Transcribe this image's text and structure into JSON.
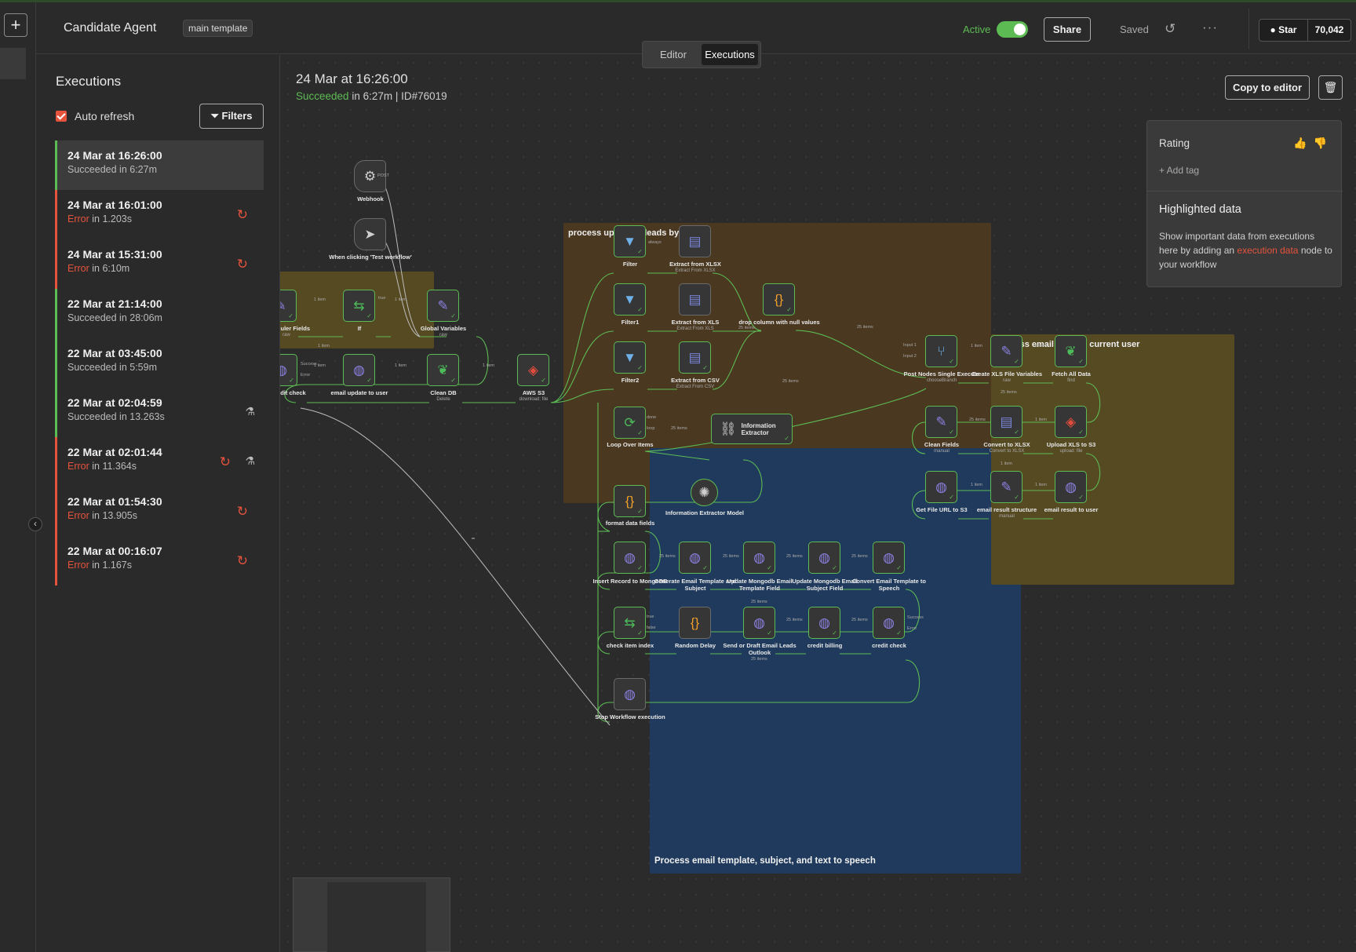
{
  "header": {
    "workflow_name": "Candidate Agent",
    "tag": "main template",
    "active_label": "Active",
    "share_label": "Share",
    "saved_label": "Saved",
    "github_star_label": "Star",
    "github_star_count": "70,042"
  },
  "tabs": [
    {
      "label": "Editor",
      "active": false
    },
    {
      "label": "Executions",
      "active": true
    }
  ],
  "executions_panel": {
    "title": "Executions",
    "auto_refresh_label": "Auto refresh",
    "auto_refresh_checked": true,
    "filters_label": "Filters",
    "items": [
      {
        "time": "24 Mar at 16:26:00",
        "status": "Succeeded",
        "duration_text": " in 6:27m",
        "state": "success",
        "selected": true,
        "retry": false,
        "test": false
      },
      {
        "time": "24 Mar at 16:01:00",
        "status": "Error",
        "duration_text": " in 1.203s",
        "state": "error",
        "selected": false,
        "retry": true,
        "test": false
      },
      {
        "time": "24 Mar at 15:31:00",
        "status": "Error",
        "duration_text": " in 6:10m",
        "state": "error",
        "selected": false,
        "retry": true,
        "test": false
      },
      {
        "time": "22 Mar at 21:14:00",
        "status": "Succeeded",
        "duration_text": " in 28:06m",
        "state": "success",
        "selected": false,
        "retry": false,
        "test": false
      },
      {
        "time": "22 Mar at 03:45:00",
        "status": "Succeeded",
        "duration_text": " in 5:59m",
        "state": "success",
        "selected": false,
        "retry": false,
        "test": false
      },
      {
        "time": "22 Mar at 02:04:59",
        "status": "Succeeded",
        "duration_text": " in 13.263s",
        "state": "success",
        "selected": false,
        "retry": false,
        "test": true
      },
      {
        "time": "22 Mar at 02:01:44",
        "status": "Error",
        "duration_text": " in 11.364s",
        "state": "error",
        "selected": false,
        "retry": true,
        "test": true
      },
      {
        "time": "22 Mar at 01:54:30",
        "status": "Error",
        "duration_text": " in 13.905s",
        "state": "error",
        "selected": false,
        "retry": true,
        "test": false
      },
      {
        "time": "22 Mar at 00:16:07",
        "status": "Error",
        "duration_text": " in 1.167s",
        "state": "error",
        "selected": false,
        "retry": true,
        "test": false
      }
    ]
  },
  "execution_detail": {
    "date": "24 Mar at 16:26:00",
    "status": "Succeeded",
    "summary_rest": " in 6:27m | ID#76019",
    "copy_to_editor_label": "Copy to editor"
  },
  "rating_panel": {
    "rating_label": "Rating",
    "add_tag_label": "+ Add tag",
    "highlighted_title": "Highlighted data",
    "highlighted_body_1": "Show important data from executions here by adding an ",
    "highlighted_link": "execution data",
    "highlighted_body_2": " node to your workflow"
  },
  "groups": {
    "uploaded": "process uploaded leads by user",
    "email_send": "Process email send to current user",
    "template": "Process email template, subject, and text to speech"
  },
  "nodes": {
    "webhook": {
      "label": "Webhook",
      "icon": "webhook-icon"
    },
    "manual_trigger": {
      "label": "When clicking 'Test workflow'",
      "icon": "cursor-icon"
    },
    "scheduler_fields": {
      "label": "Scheduler Fields",
      "sub": "raw",
      "icon": "pencil-icon"
    },
    "if": {
      "label": "If",
      "icon": "if-icon"
    },
    "global_variables": {
      "label": "Global Variables",
      "sub": "raw",
      "icon": "pencil-icon"
    },
    "initial_credit_check": {
      "label": "Initial credit check",
      "icon": "globe-icon"
    },
    "email_update_to_user": {
      "label": "email update to user",
      "icon": "globe-icon"
    },
    "clean_db": {
      "label": "Clean DB",
      "sub": "Delete",
      "icon": "mongodb-icon"
    },
    "aws_s3": {
      "label": "AWS S3",
      "sub": "download: file",
      "icon": "aws-s3-icon"
    },
    "filter": {
      "label": "Filter",
      "icon": "filter-icon"
    },
    "filter1": {
      "label": "Filter1",
      "icon": "filter-icon"
    },
    "filter2": {
      "label": "Filter2",
      "icon": "filter-icon"
    },
    "extract_xlsx": {
      "label": "Extract from XLSX",
      "sub": "Extract From XLSX",
      "icon": "file-icon"
    },
    "extract_xls": {
      "label": "Extract from XLS",
      "sub": "Extract From XLS",
      "icon": "file-icon"
    },
    "extract_csv": {
      "label": "Extract from CSV",
      "sub": "Extract From CSV",
      "icon": "file-icon"
    },
    "drop_column": {
      "label": "drop column with null values",
      "icon": "code-icon"
    },
    "loop_over_items": {
      "label": "Loop Over Items",
      "icon": "loop-icon"
    },
    "information_extractor": {
      "label": "Information Extractor",
      "icon": "extractor-icon"
    },
    "information_extractor_model": {
      "label": "Information Extractor Model",
      "icon": "openai-icon"
    },
    "format_data_fields": {
      "label": "format data fields",
      "icon": "code-icon"
    },
    "insert_record": {
      "label": "Insert Record to MongoDB",
      "icon": "globe-icon"
    },
    "generate_email_template": {
      "label": "Generate Email Template and Subject",
      "icon": "globe-icon"
    },
    "update_mongodb_template": {
      "label": "Update Mongodb Email Template Field",
      "icon": "globe-icon"
    },
    "update_mongodb_subject": {
      "label": "Update Mongodb Email Subject Field",
      "icon": "globe-icon"
    },
    "convert_email_template": {
      "label": "Convert Email Template to Speech",
      "icon": "globe-icon"
    },
    "check_item_index": {
      "label": "check item index",
      "icon": "if-icon"
    },
    "random_delay": {
      "label": "Random Delay",
      "icon": "code-icon"
    },
    "send_or_draft": {
      "label": "Send or Draft Email Leads Outlook",
      "icon": "globe-icon"
    },
    "credit_billing": {
      "label": "credit billing",
      "icon": "globe-icon"
    },
    "credit_check": {
      "label": "credit check",
      "icon": "globe-icon"
    },
    "stop_workflow": {
      "label": "Stop Workflow execution",
      "icon": "globe-icon"
    },
    "post_nodes": {
      "label": "Post Nodes Single Execute",
      "sub": "chooseBranch",
      "icon": "merge-icon"
    },
    "create_xls_vars": {
      "label": "Create XLS File Variables",
      "sub": "raw",
      "icon": "pencil-icon"
    },
    "fetch_all_data": {
      "label": "Fetch All Data",
      "sub": "find",
      "icon": "mongodb-icon"
    },
    "clean_fields": {
      "label": "Clean Fields",
      "sub": "manual",
      "icon": "pencil-icon"
    },
    "convert_to_xlsx": {
      "label": "Convert to XLSX",
      "sub": "Convert to XLSX",
      "icon": "file-icon"
    },
    "upload_xls_s3": {
      "label": "Upload XLS to S3",
      "sub": "upload: file",
      "icon": "aws-s3-icon"
    },
    "get_file_url": {
      "label": "Get File URL to S3",
      "icon": "globe-icon"
    },
    "email_result_structure": {
      "label": "email result structure",
      "sub": "manual",
      "icon": "pencil-icon"
    },
    "email_result_to_user": {
      "label": "email result to user",
      "icon": "globe-icon"
    }
  },
  "edge_labels": {
    "one_item": "1 item",
    "items_25": "25 items",
    "true": "true",
    "false": "false",
    "always": "always",
    "done": "done",
    "loop": "loop",
    "success": "Success",
    "error": "Error",
    "post": "POST",
    "input1": "Input 1",
    "input2": "Input 2"
  },
  "colors": {
    "success": "#5dbb54",
    "error": "#e5533d",
    "group_brown": "#4a3820",
    "group_olive": "#564a22",
    "group_blue": "#1f3a5c"
  }
}
